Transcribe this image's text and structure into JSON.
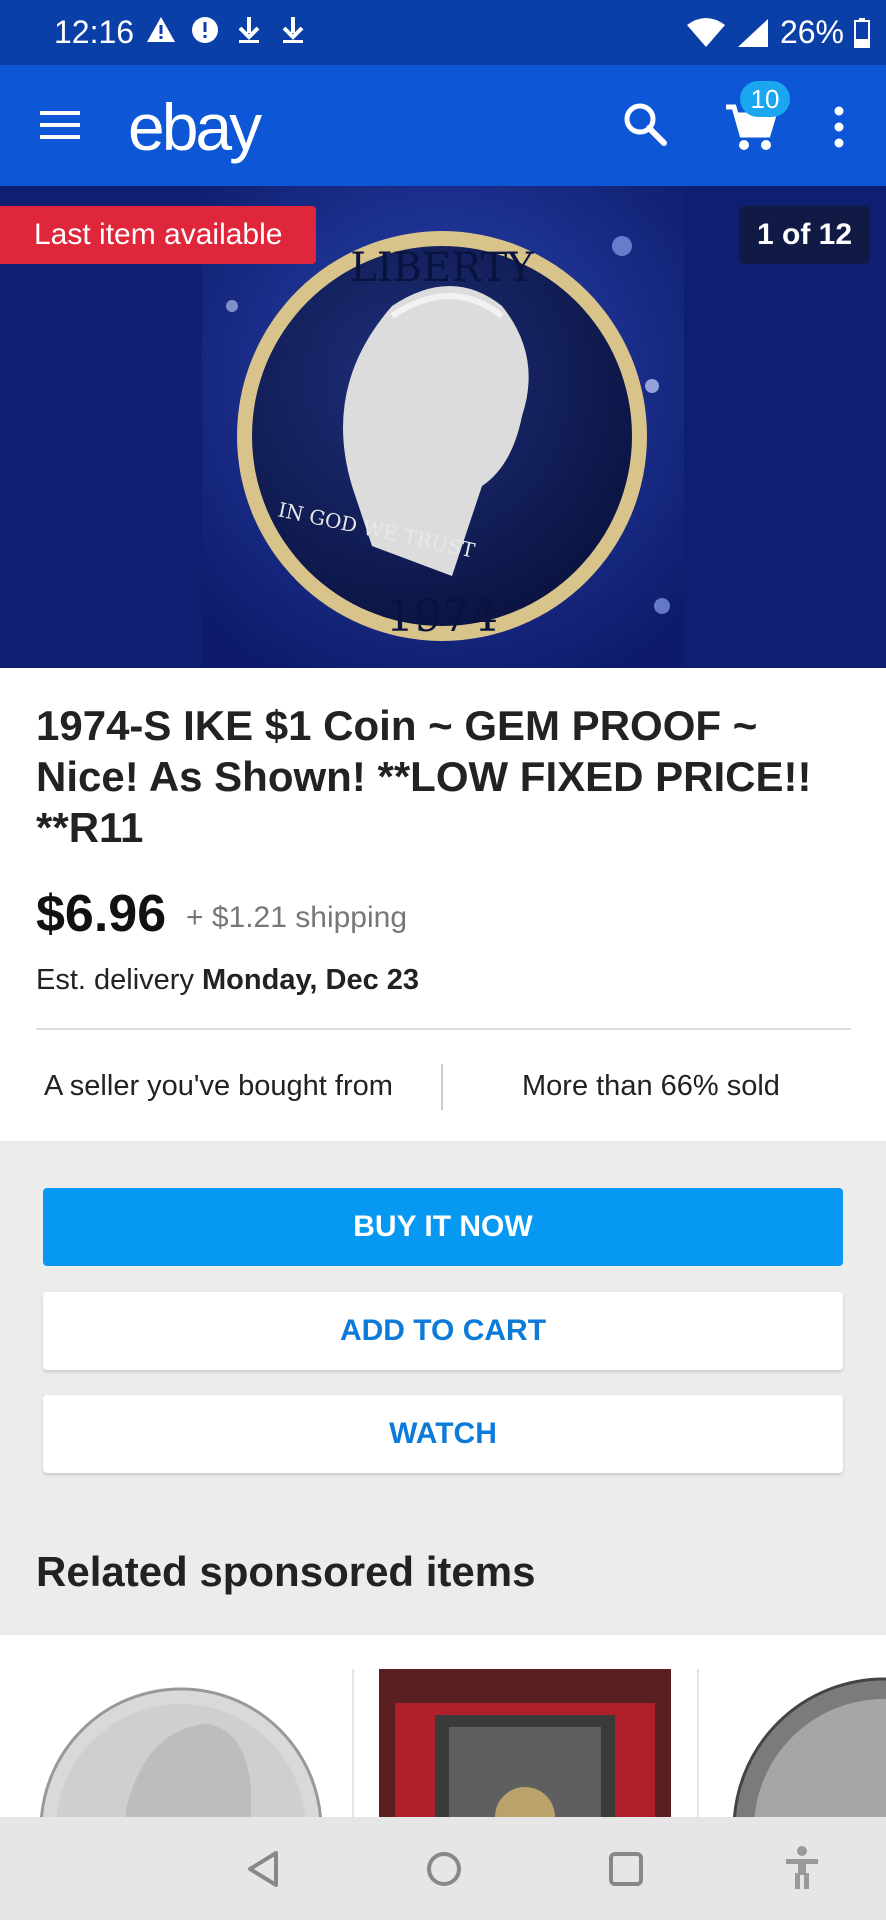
{
  "status_bar": {
    "time": "12:16",
    "battery": "26%",
    "left_icons": [
      "warning-icon",
      "alert-icon",
      "download-icon",
      "download-icon"
    ],
    "right_icons": [
      "wifi-icon",
      "signal-icon",
      "battery-icon"
    ]
  },
  "app_bar": {
    "logo": "ebay",
    "cart_count": "10",
    "icons": [
      "menu-icon",
      "search-icon",
      "cart-icon",
      "more-vert-icon"
    ],
    "color": "#0d57d6"
  },
  "hero": {
    "banner": "Last item available",
    "counter": "1 of 12",
    "coin": {
      "top_text": "LIBERTY",
      "motto": "IN GOD WE TRUST",
      "year": "1974"
    }
  },
  "listing": {
    "title": "1974-S IKE $1 Coin ~ GEM PROOF ~ Nice! As Shown! **LOW FIXED PRICE!! **R11",
    "price": "$6.96",
    "shipping": "+ $1.21 shipping",
    "delivery_label": "Est. delivery",
    "delivery_date": "Monday, Dec 23",
    "badges": [
      "A seller you've bought from",
      "More than 66% sold"
    ]
  },
  "actions": {
    "buy_now": "BUY IT NOW",
    "add_to_cart": "ADD TO CART",
    "watch": "WATCH",
    "primary_color": "#0798f2"
  },
  "related": {
    "heading": "Related sponsored items"
  },
  "nav_bar": {
    "icons": [
      "back-icon",
      "home-icon",
      "recents-icon",
      "accessibility-icon"
    ]
  }
}
